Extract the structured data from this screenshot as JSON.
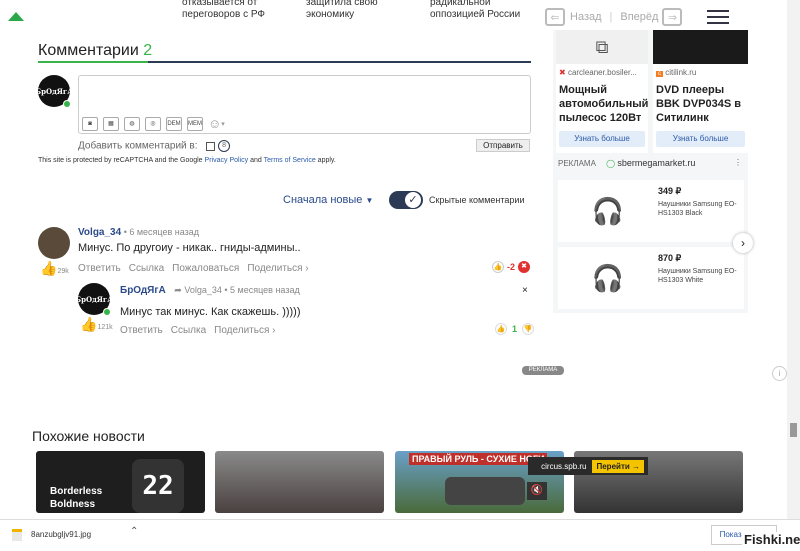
{
  "top": {
    "col1": "отказывается от переговоров с РФ",
    "col2": "защитила свою экономику",
    "col3": "радикальной оппозицией России"
  },
  "nav": {
    "back": "Назад",
    "forward": "Вперёд"
  },
  "comments": {
    "title": "Комментарии",
    "count": "2",
    "add_label": "Добавить комментарий в:",
    "badge": "8",
    "send": "Отправить",
    "toolbar": [
      "DEM",
      "MEM"
    ],
    "captcha_prefix": "This site is protected by reCAPTCHA and the Google",
    "privacy": "Privacy Policy",
    "and": "and",
    "terms": "Terms of Service",
    "apply": "apply.",
    "sort": "Сначала новые",
    "hidden_label": "Скрытые комментарии"
  },
  "comment1": {
    "author": "Volga_34",
    "time": "• 6 месяцев назад",
    "text": "Минус. По другоиу - никак.. гниды-админы..",
    "rating": "29k",
    "actions": [
      "Ответить",
      "Ссылка",
      "Пожаловаться",
      "Поделиться ›"
    ],
    "score": "-2",
    "avatar_color": "#5a4a3a"
  },
  "comment2": {
    "author": "БрОдЯгА",
    "reply_to": "Volga_34",
    "time": "• 5 месяцев назад",
    "text": "Минус так минус. Как скажешь. )))))",
    "rating": "121k",
    "actions": [
      "Ответить",
      "Ссылка",
      "Поделиться ›"
    ],
    "score": "1",
    "avatar_text": "БрОдЯгА"
  },
  "ad_tag": "РЕКЛАМА",
  "ads": {
    "card1": {
      "source": "carcleaner.bosiler...",
      "title": "Мощный автомобильный пылесос 120Вт",
      "button": "Узнать больше"
    },
    "card2": {
      "source": "citilink.ru",
      "title": "DVD плееры BBK DVP034S в Ситилинк",
      "button": "Узнать больше"
    },
    "reklama": "РЕКЛАМА",
    "market": "sbermegamarket.ru",
    "products": [
      {
        "price": "349 ₽",
        "desc": "Наушники Samsung EO-HS1303 Black"
      },
      {
        "price": "870 ₽",
        "desc": "Наушники Samsung EO-HS1303 White"
      }
    ]
  },
  "similar": {
    "title": "Похожие новости",
    "card1_text1": "Borderless",
    "card1_text2": "Boldness",
    "card1_clock": "22",
    "card3_banner": "ПРАВЫЙ РУЛЬ - СУХИЕ НОГИ",
    "overlay_site": "circus.spb.ru",
    "overlay_btn": "Перейти →"
  },
  "download": {
    "filename": "8anzubgljv91.jpg",
    "show_all": "Показать все"
  },
  "watermark": "Fishki.net"
}
